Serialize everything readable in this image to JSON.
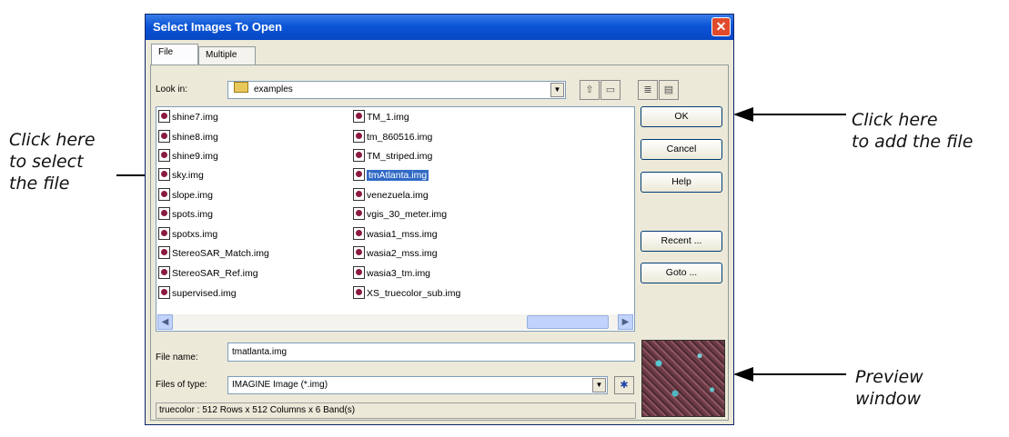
{
  "window": {
    "title": "Select Images To Open"
  },
  "tabs": [
    {
      "label": "File"
    },
    {
      "label": "Multiple"
    }
  ],
  "look_in": {
    "label": "Look in:",
    "value": "examples"
  },
  "files_col1": [
    "shine7.img",
    "shine8.img",
    "shine9.img",
    "sky.img",
    "slope.img",
    "spots.img",
    "spotxs.img",
    "StereoSAR_Match.img",
    "StereoSAR_Ref.img",
    "supervised.img"
  ],
  "files_col2": [
    "TM_1.img",
    "tm_860516.img",
    "TM_striped.img",
    "tmAtlanta.img",
    "venezuela.img",
    "vgis_30_meter.img",
    "wasia1_mss.img",
    "wasia2_mss.img",
    "wasia3_tm.img",
    "XS_truecolor_sub.img"
  ],
  "selected_file": "tmAtlanta.img",
  "buttons": {
    "ok": "OK",
    "cancel": "Cancel",
    "help": "Help",
    "recent": "Recent ...",
    "goto": "Goto ..."
  },
  "file_name": {
    "label": "File name:",
    "value": "tmatlanta.img"
  },
  "files_of_type": {
    "label": "Files of type:",
    "value": "IMAGINE Image (*.img)"
  },
  "status": "truecolor : 512 Rows x 512 Columns x 6 Band(s)",
  "callouts": {
    "select": [
      "Click here",
      "to select",
      "the file"
    ],
    "add": [
      "Click here",
      "to add the file"
    ],
    "preview": [
      "Preview",
      "window"
    ]
  }
}
